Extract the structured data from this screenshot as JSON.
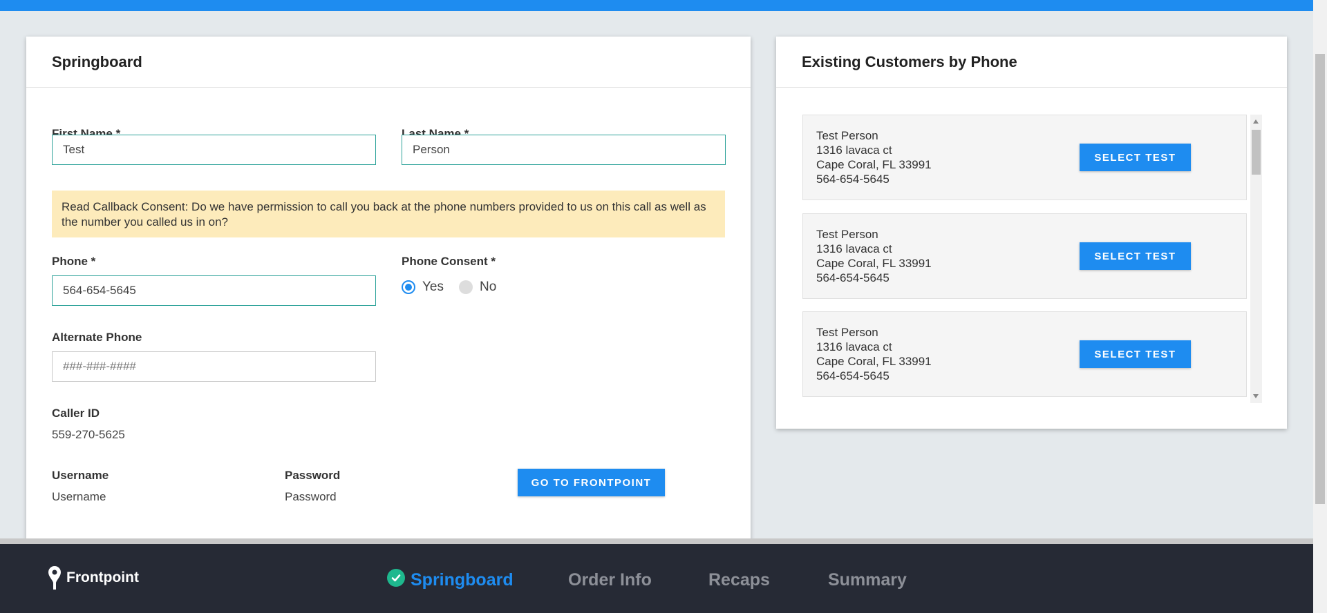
{
  "springboard": {
    "title": "Springboard",
    "first_name": {
      "label": "First Name *",
      "value": "Test"
    },
    "last_name": {
      "label": "Last Name *",
      "value": "Person"
    },
    "consent_text": "Read Callback Consent: Do we have permission to call you back at the phone numbers provided to us on this call as well as the number you called us in on?",
    "phone": {
      "label": "Phone *",
      "value": "564-654-5645"
    },
    "phone_consent": {
      "label": "Phone Consent *",
      "yes": "Yes",
      "no": "No",
      "selected": "Yes"
    },
    "alternate_phone": {
      "label": "Alternate Phone",
      "placeholder": "###-###-####"
    },
    "caller_id": {
      "label": "Caller ID",
      "value": "559-270-5625"
    },
    "username": {
      "label": "Username",
      "value": "Username"
    },
    "password": {
      "label": "Password",
      "value": "Password"
    },
    "go_button": "GO TO FRONTPOINT"
  },
  "existing_customers": {
    "title": "Existing Customers by Phone",
    "customers": [
      {
        "name": "Test Person",
        "street": "1316 lavaca ct",
        "city": "Cape Coral, FL 33991",
        "phone": "564-654-5645",
        "button": "SELECT TEST"
      },
      {
        "name": "Test Person",
        "street": "1316 lavaca ct",
        "city": "Cape Coral, FL 33991",
        "phone": "564-654-5645",
        "button": "SELECT TEST"
      },
      {
        "name": "Test Person",
        "street": "1316 lavaca ct",
        "city": "Cape Coral, FL 33991",
        "phone": "564-654-5645",
        "button": "SELECT TEST"
      }
    ]
  },
  "footer": {
    "logo": "Frontpoint",
    "steps": [
      "Springboard",
      "Order Info",
      "Recaps",
      "Summary"
    ],
    "active_step": "Springboard"
  },
  "colors": {
    "primary": "#1e8cf0",
    "accent_teal": "#2aa198",
    "footer_bg": "#262a35",
    "consent_bg": "#fdebbb",
    "check_green": "#1eb88e"
  }
}
